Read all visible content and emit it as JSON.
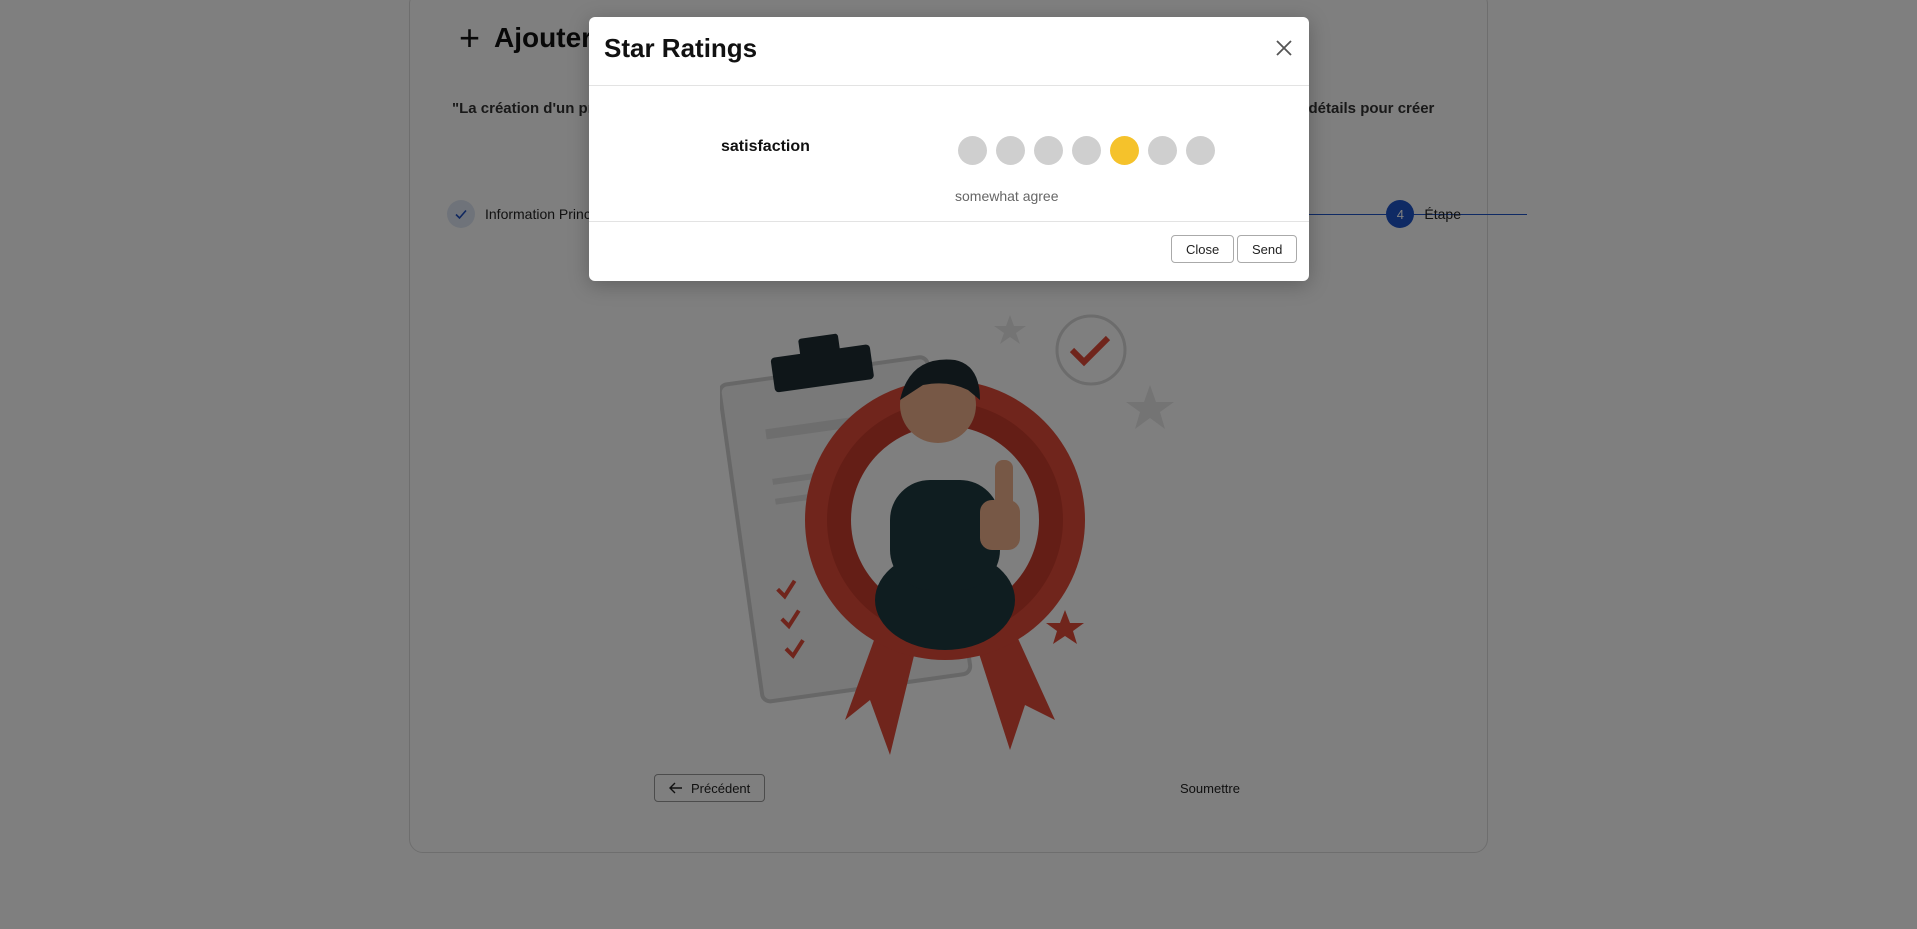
{
  "page": {
    "title": "Ajouter",
    "description_left": "\"La création d'un pr",
    "description_right": "s détails pour créer",
    "steps": {
      "first_label": "Information Princ",
      "last_number": "4",
      "last_label": "Étape"
    },
    "prev_label": "Précédent",
    "submit_label": "Soumettre"
  },
  "modal": {
    "title": "Star Ratings",
    "rating_label": "satisfaction",
    "rating_scale": 7,
    "rating_value": 5,
    "rating_text": "somewhat agree",
    "close_label": "Close",
    "send_label": "Send"
  },
  "colors": {
    "selected": "#f5c22b",
    "unselected": "#cfcfcf",
    "accent": "#1f54c9"
  }
}
